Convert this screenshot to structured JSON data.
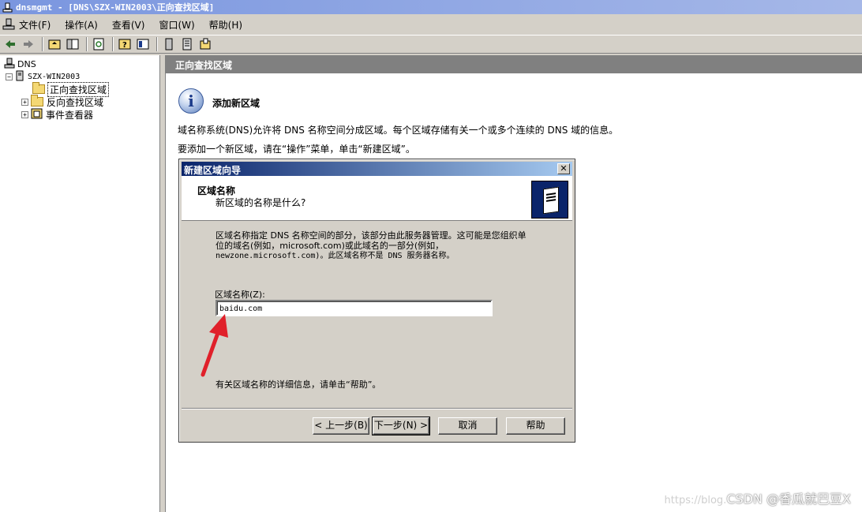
{
  "window": {
    "title": "dnsmgmt - [DNS\\SZX-WIN2003\\正向查找区域]"
  },
  "menu": [
    "文件(F)",
    "操作(A)",
    "查看(V)",
    "窗口(W)",
    "帮助(H)"
  ],
  "tree": {
    "root": "DNS",
    "server": "SZX-WIN2003",
    "items": [
      "正向查找区域",
      "反向查找区域",
      "事件查看器"
    ]
  },
  "pane": {
    "header": "正向查找区域",
    "heading": "添加新区域",
    "desc1": "域名称系统(DNS)允许将 DNS 名称空间分成区域。每个区域存储有关一个或多个连续的 DNS 域的信息。",
    "desc2": "要添加一个新区域，请在“操作”菜单，单击“新建区域”。"
  },
  "dialog": {
    "title": "新建区域向导",
    "close": "✕",
    "section_title": "区域名称",
    "section_subtitle": "新区域的名称是什么?",
    "body_line1": "区域名称指定 DNS 名称空间的部分，该部分由此服务器管理。这可能是您组织单",
    "body_line2": "位的域名(例如，microsoft.com)或此域名的一部分(例如，",
    "body_line3": "newzone.microsoft.com)。此区域名称不是 DNS 服务器名称。",
    "zone_label": "区域名称(Z):",
    "zone_value": "baidu.com",
    "help_text": "有关区域名称的详细信息，请单击“帮助”。",
    "back_label": "< 上一步(B)",
    "next_label": "下一步(N) >",
    "cancel_label": "取消",
    "help_label": "帮助"
  },
  "watermark": {
    "faint": "https://blog.",
    "text": "CSDN @香瓜就巴豆X"
  },
  "colors": {
    "titlebar": "#7a96df",
    "dialog_title": "#0a246a",
    "arrow": "#e0202a"
  }
}
